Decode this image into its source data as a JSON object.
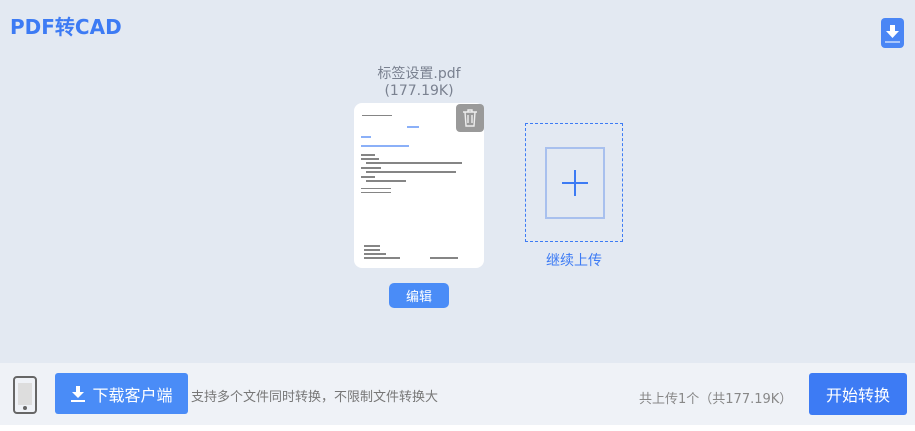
{
  "header": {
    "title": "PDF转CAD"
  },
  "file": {
    "name": "标签设置.pdf",
    "size": "(177.19K)",
    "edit_label": "编辑"
  },
  "upload": {
    "label": "继续上传"
  },
  "footer": {
    "download_label": "下载客户端",
    "hint": "支持多个文件同时转换，不限制文件转换大",
    "count": "共上传1个（共177.19K）",
    "start_label": "开始转换"
  },
  "colors": {
    "accent": "#3d7bf4"
  }
}
